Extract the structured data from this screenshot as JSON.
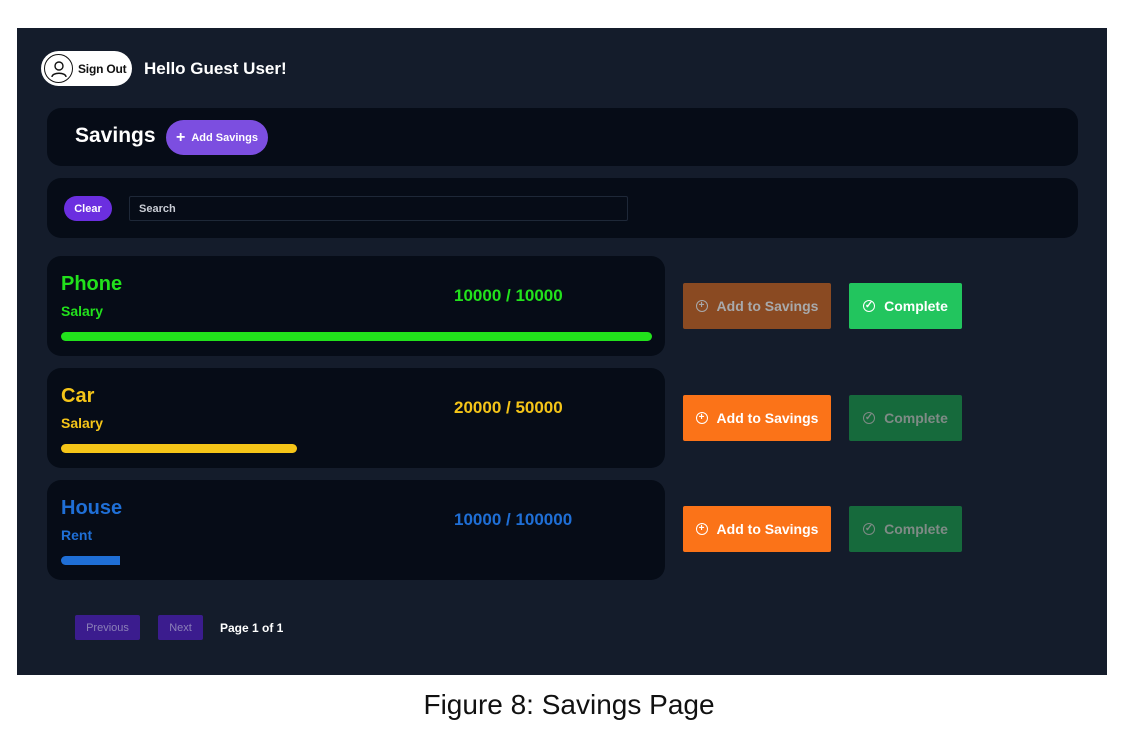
{
  "header": {
    "sign_out_label": "Sign Out",
    "greeting": "Hello Guest User!"
  },
  "toolbar": {
    "title": "Savings",
    "add_savings_label": "Add Savings"
  },
  "filters": {
    "clear_label": "Clear",
    "search_placeholder": "Search",
    "search_value": ""
  },
  "savings": [
    {
      "name": "Phone",
      "source": "Salary",
      "amount_text": "10000 / 10000",
      "progress": 1.0,
      "color": "#22e21c",
      "add_label": "Add to Savings",
      "add_disabled": true,
      "complete_label": "Complete",
      "complete_disabled": false
    },
    {
      "name": "Car",
      "source": "Salary",
      "amount_text": "20000 / 50000",
      "progress": 0.4,
      "color": "#f5c518",
      "add_label": "Add to Savings",
      "add_disabled": false,
      "complete_label": "Complete",
      "complete_disabled": true
    },
    {
      "name": "House",
      "source": "Rent",
      "amount_text": "10000 / 100000",
      "progress": 0.1,
      "color": "#1f6fd6",
      "add_label": "Add to Savings",
      "add_disabled": false,
      "complete_label": "Complete",
      "complete_disabled": true
    }
  ],
  "pagination": {
    "previous_label": "Previous",
    "next_label": "Next",
    "page_text": "Page 1 of 1"
  },
  "caption": "Figure 8: Savings Page",
  "colors": {
    "background": "#141c2b",
    "panel": "#060c17",
    "accent_purple": "#7c4ee0",
    "orange": "#fb7318",
    "green": "#22c55e"
  }
}
